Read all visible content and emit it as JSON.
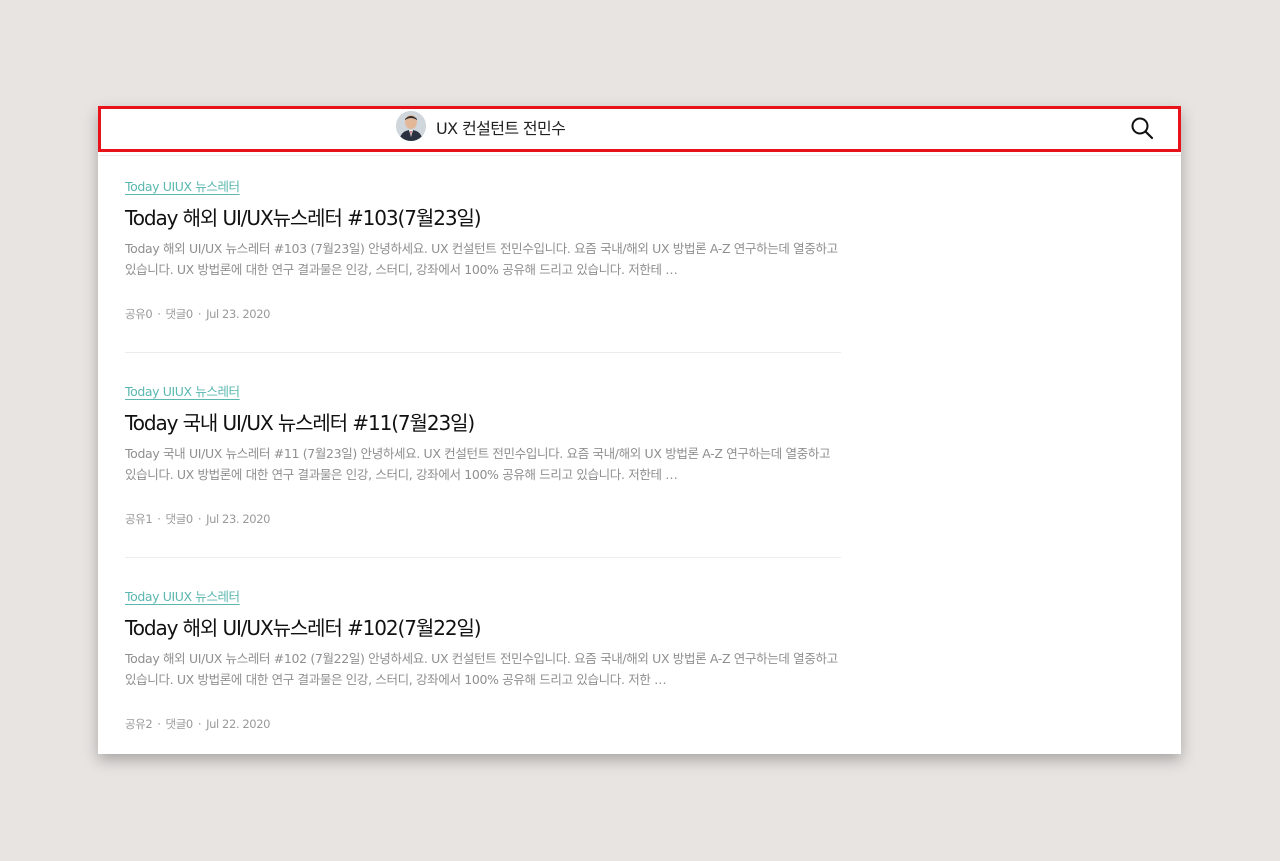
{
  "header": {
    "site_title": "UX 컨설턴트 전민수",
    "search_icon": "search-icon",
    "highlight_color": "#e8121b"
  },
  "posts": [
    {
      "category": "Today UIUX 뉴스레터",
      "title": "Today 해외 UI/UX뉴스레터 #103(7월23일)",
      "excerpt": "Today 해외 UI/UX 뉴스레터 #103 (7월23일) 안녕하세요. UX 컨설턴트 전민수입니다. 요즘 국내/해외 UX 방법론 A-Z 연구하는데 열중하고 있습니다. UX 방법론에 대한 연구 결과물은 인강, 스터디, 강좌에서 100% 공유해 드리고 있습니다. 저한테 …",
      "shares": "공유0",
      "comments": "댓글0",
      "date": "Jul 23. 2020"
    },
    {
      "category": "Today UIUX 뉴스레터",
      "title": "Today 국내 UI/UX 뉴스레터 #11(7월23일)",
      "excerpt": "Today 국내 UI/UX 뉴스레터 #11 (7월23일) 안녕하세요. UX 컨설턴트 전민수입니다. 요즘 국내/해외 UX 방법론 A-Z 연구하는데 열중하고 있습니다. UX 방법론에 대한 연구 결과물은 인강, 스터디, 강좌에서 100% 공유해 드리고 있습니다. 저한테 …",
      "shares": "공유1",
      "comments": "댓글0",
      "date": "Jul 23. 2020"
    },
    {
      "category": "Today UIUX 뉴스레터",
      "title": "Today 해외 UI/UX뉴스레터 #102(7월22일)",
      "excerpt": "Today 해외 UI/UX 뉴스레터 #102 (7월22일) 안녕하세요. UX 컨설턴트 전민수입니다. 요즘 국내/해외 UX 방법론 A-Z 연구하는데 열중하고 있습니다. UX 방법론에 대한 연구 결과물은 인강, 스터디, 강좌에서 100% 공유해 드리고 있습니다. 저한 …",
      "shares": "공유2",
      "comments": "댓글0",
      "date": "Jul 22. 2020"
    }
  ],
  "meta_separator": "·",
  "colors": {
    "category": "#5bb7b0",
    "title": "#111111",
    "excerpt": "#8f8f8f",
    "meta": "#9a9a9a",
    "background": "#e8e4e2"
  }
}
